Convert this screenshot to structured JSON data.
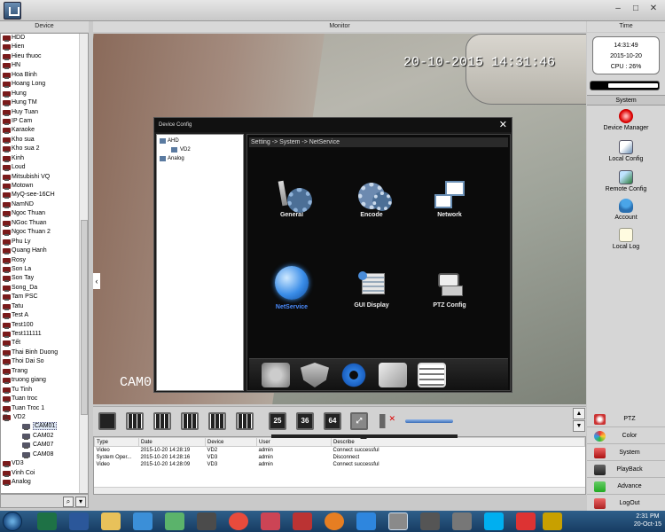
{
  "headers": {
    "device": "Device",
    "monitor": "Monitor",
    "time": "Time"
  },
  "device_tree": {
    "items": [
      "HDD",
      "Hien",
      "Hieu thuoc",
      "HN",
      "Hoa Binh",
      "Hoang Long",
      "Hung",
      "Hung TM",
      "Huy Tuan",
      "IP Cam",
      "Karaoke",
      "Kho sua",
      "Kho sua 2",
      "Kinh",
      "Loud",
      "Mitsubishi VQ",
      "Motown",
      "MyQ-see-16CH",
      "NamND",
      "Ngoc Thuan",
      "NGoc Thuan",
      "Ngoc Thuan 2",
      "Phu Ly",
      "Quang Hanh",
      "Rosy",
      "Son La",
      "Son Tay",
      "Song_Da",
      "Tam PSC",
      "Tatu",
      "Test A",
      "Test100",
      "Test111111",
      "Tết",
      "Thai Binh Duong",
      "Thoi Dai So",
      "Trang",
      "truong giang",
      "Tu Tinh",
      "Tuan troc",
      "Tuan Troc 1"
    ],
    "expanded_device": "VD2",
    "expanded_toggle": "⊟",
    "cameras": [
      "CAM01",
      "CAM02",
      "CAM07",
      "CAM08"
    ],
    "selected_camera": "CAM01",
    "after_items": [
      "VD3",
      "Vinh Coi",
      "Analog"
    ]
  },
  "monitor": {
    "timestamp": "20-10-2015 14:31:46",
    "camera_label": "CAM0",
    "left_arrow": "‹"
  },
  "dialog": {
    "title": "Device Config",
    "close": "✕",
    "tree": {
      "root": "AHD",
      "child": "VD2",
      "other": "Analog"
    },
    "breadcrumb": "Setting -> System -> NetService",
    "items": [
      {
        "label": "General",
        "icon": "general-icon"
      },
      {
        "label": "Encode",
        "icon": "encode-icon"
      },
      {
        "label": "Network",
        "icon": "network-icon"
      },
      {
        "label": "NetService",
        "icon": "globe-icon"
      },
      {
        "label": "GUI Display",
        "icon": "gui-display-icon"
      },
      {
        "label": "PTZ Config",
        "icon": "ptz-camera-icon"
      }
    ],
    "active_item": "NetService"
  },
  "status": {
    "time": "14:31:49",
    "date": "2015-10-20",
    "cpu": "CPU : 26%",
    "cpu_level": 0.74
  },
  "system": {
    "title": "System",
    "items": [
      "Device Manager",
      "Local Config",
      "Remote Config",
      "Account",
      "Local Log"
    ]
  },
  "right_menu": [
    "PTZ",
    "Color",
    "System",
    "PlayBack",
    "Advance",
    "LogOut"
  ],
  "layout_buttons": [
    "25",
    "36",
    "64"
  ],
  "log": {
    "columns": [
      "Type",
      "Date",
      "Device",
      "User",
      "Describe"
    ],
    "rows": [
      [
        "Video",
        "2015-10-20 14:28:19",
        "VD2",
        "admin",
        "Connect successful"
      ],
      [
        "System Oper...",
        "2015-10-20 14:28:16",
        "VD3",
        "admin",
        "Disconnect"
      ],
      [
        "Video",
        "2015-10-20 14:28:09",
        "VD3",
        "admin",
        "Connect successful"
      ]
    ]
  },
  "taskbar": {
    "time": "2:31 PM",
    "date": "20-Oct-15"
  },
  "colors": {
    "accent_blue": "#4a8cff",
    "dialog_bg": "#1b1b1b",
    "panel_bg": "#d6d6d6"
  }
}
